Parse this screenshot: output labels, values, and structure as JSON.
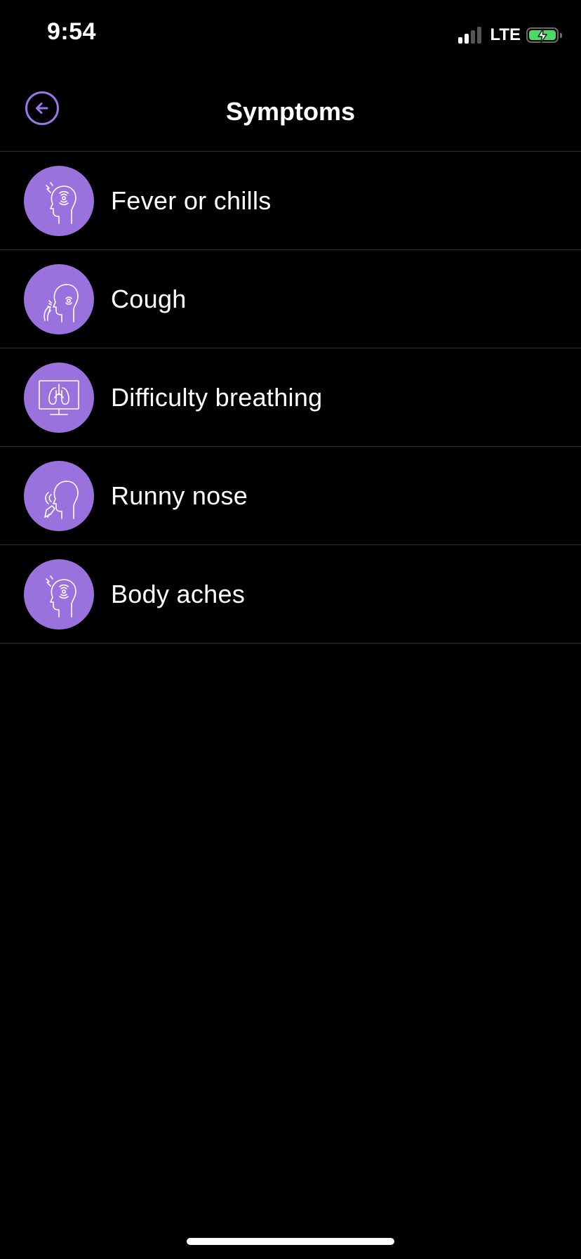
{
  "status_bar": {
    "time": "9:54",
    "network": "LTE",
    "battery_color": "#4cd964",
    "signal_bars_active": 2,
    "signal_bars_total": 4
  },
  "header": {
    "title": "Symptoms",
    "back_icon": "arrow-left-circle-icon"
  },
  "theme": {
    "accent": "#9b77e4",
    "icon_background": "#9a72dd",
    "background": "#000000",
    "divider": "#2e2e2e"
  },
  "symptoms": [
    {
      "label": "Fever or chills",
      "icon": "fever-head-icon"
    },
    {
      "label": "Cough",
      "icon": "cough-head-icon"
    },
    {
      "label": "Difficulty breathing",
      "icon": "lungs-monitor-icon"
    },
    {
      "label": "Runny nose",
      "icon": "runny-nose-head-icon"
    },
    {
      "label": "Body aches",
      "icon": "body-aches-head-icon"
    }
  ]
}
